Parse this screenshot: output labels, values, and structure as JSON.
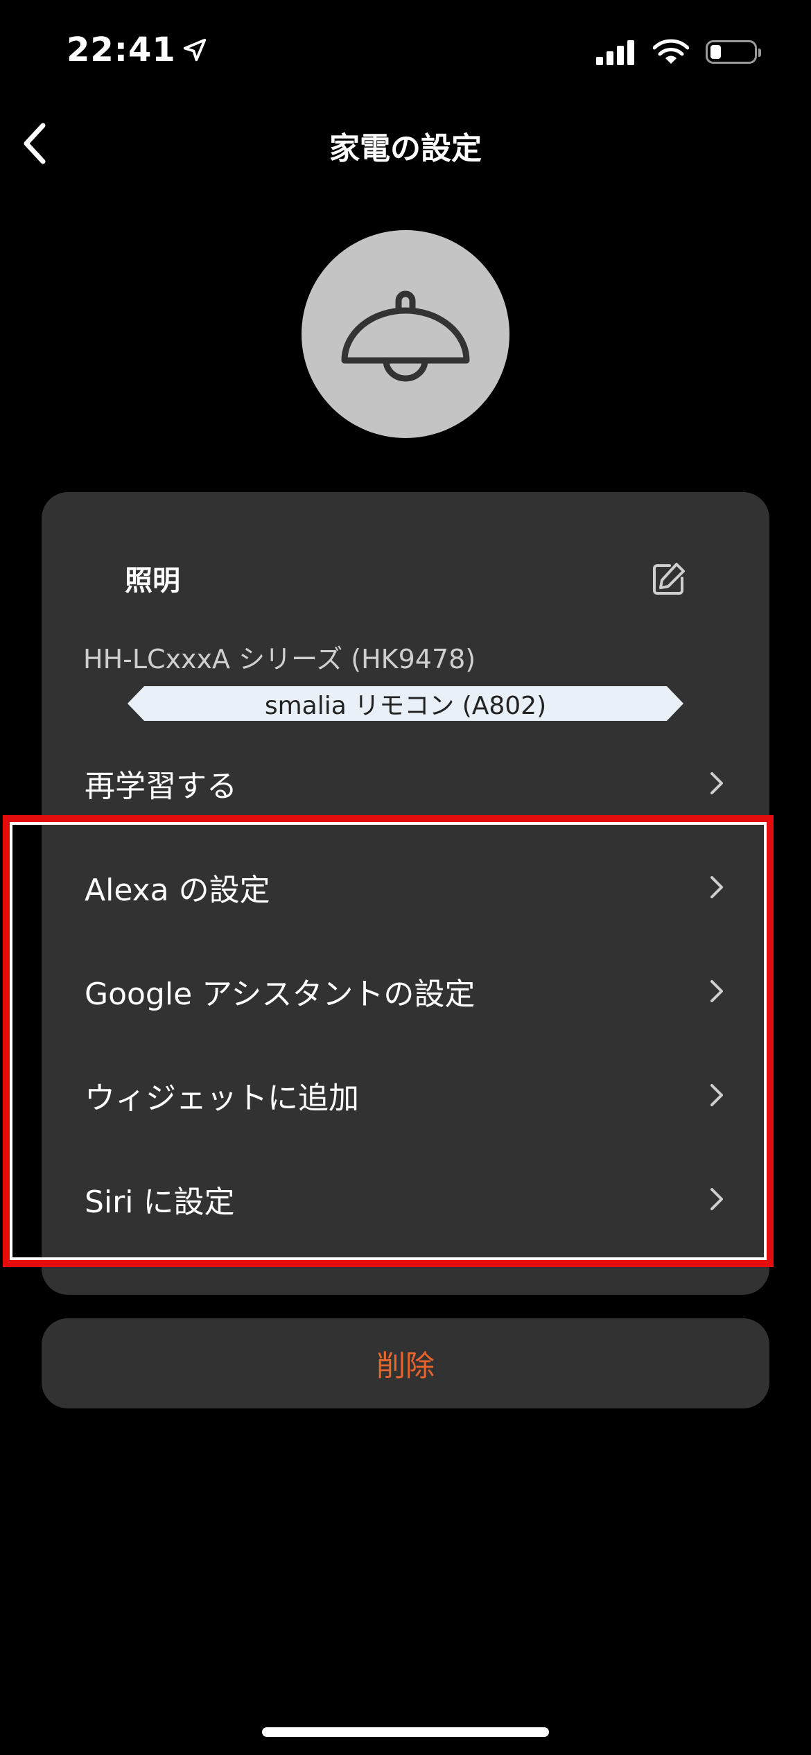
{
  "status_bar": {
    "time": "22:41",
    "icons": [
      "location-arrow-icon",
      "cellular-signal-icon",
      "wifi-icon",
      "battery-icon"
    ],
    "battery_level": 0.25
  },
  "header": {
    "title": "家電の設定",
    "back_icon": "chevron-left-icon"
  },
  "device": {
    "icon": "ceiling-lamp-icon",
    "name": "照明",
    "model": "HH-LCxxxA シリーズ (HK9478)",
    "remote": "smalia リモコン (A802)"
  },
  "menu": {
    "items": [
      {
        "label": "再学習する"
      },
      {
        "label": "Alexa の設定"
      },
      {
        "label": "Google アシスタントの設定"
      },
      {
        "label": "ウィジェットに追加"
      },
      {
        "label": "Siri に設定"
      }
    ]
  },
  "actions": {
    "delete_label": "削除"
  },
  "colors": {
    "background": "#000000",
    "card": "#323232",
    "avatar": "#c4c4c4",
    "delete_text": "#e8642c",
    "highlight": "#e40c0c",
    "badge": "#e9f0f8"
  }
}
